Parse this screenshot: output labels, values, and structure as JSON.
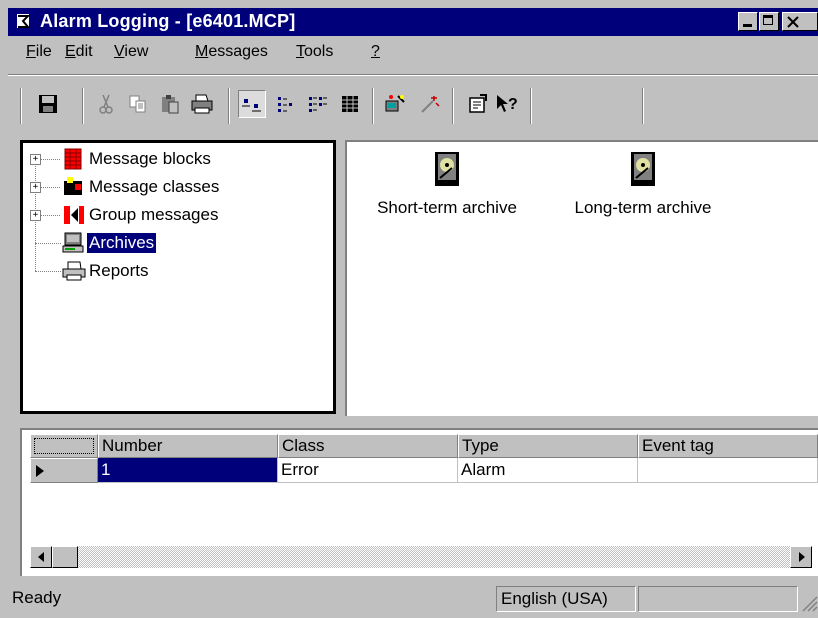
{
  "window": {
    "title": "Alarm Logging - [e6401.MCP]"
  },
  "menubar": {
    "items": [
      {
        "label": "File",
        "mnemonic": "F",
        "rest": "ile"
      },
      {
        "label": "Edit",
        "mnemonic": "E",
        "rest": "dit"
      },
      {
        "label": "View",
        "mnemonic": "V",
        "rest": "iew"
      },
      {
        "label": "Messages",
        "mnemonic": "M",
        "rest": "essages"
      },
      {
        "label": "Tools",
        "mnemonic": "T",
        "rest": "ools"
      },
      {
        "label": "?",
        "mnemonic": "?",
        "rest": ""
      }
    ]
  },
  "toolbar": {
    "buttons": [
      "save-icon",
      "cut-icon",
      "copy-icon",
      "paste-icon",
      "print-icon",
      "large-icons-view-icon",
      "small-icons-view-icon",
      "list-view-icon",
      "details-view-icon",
      "wizard-icon",
      "magic-wand-icon",
      "properties-icon",
      "context-help-icon"
    ]
  },
  "tree": {
    "items": [
      {
        "label": "Message blocks",
        "expandable": true,
        "selected": false
      },
      {
        "label": "Message classes",
        "expandable": true,
        "selected": false
      },
      {
        "label": "Group messages",
        "expandable": true,
        "selected": false
      },
      {
        "label": "Archives",
        "expandable": false,
        "selected": true
      },
      {
        "label": "Reports",
        "expandable": false,
        "selected": false
      }
    ]
  },
  "archives": {
    "items": [
      {
        "label": "Short-term archive"
      },
      {
        "label": "Long-term archive"
      }
    ]
  },
  "grid": {
    "columns": [
      "Number",
      "Class",
      "Type",
      "Event tag"
    ],
    "rows": [
      {
        "number": "1",
        "class": "Error",
        "type": "Alarm",
        "event_tag": ""
      }
    ]
  },
  "statusbar": {
    "status": "Ready",
    "language": "English (USA)"
  },
  "colors": {
    "titlebar": "#00007b",
    "selection": "#00007b",
    "face": "#c0c0c0"
  }
}
